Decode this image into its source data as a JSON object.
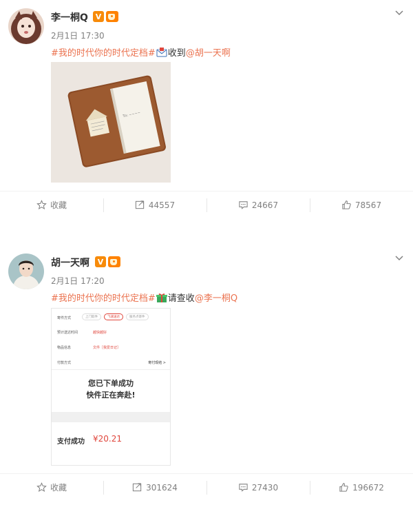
{
  "posts": [
    {
      "username": "李一桐Q",
      "time": "2月1日 17:30",
      "hashtag": "#我的时代你的时代定档#",
      "text": "收到",
      "mention": "@胡一天啊",
      "emoji": "envelope-icon",
      "actions": {
        "favorite": "收藏",
        "repost": "44557",
        "comment": "24667",
        "like": "78567"
      }
    },
    {
      "username": "胡一天啊",
      "time": "2月1日 17:20",
      "hashtag": "#我的时代你的时代定档#",
      "text": "请查收",
      "mention": "@李一桐Q",
      "emoji": "gift-icon",
      "actions": {
        "favorite": "收藏",
        "repost": "301624",
        "comment": "27430",
        "like": "196672"
      },
      "screenshot": {
        "rows": [
          {
            "label": "寄件方式",
            "options": [
              "上门取件",
              "飞速送达",
              "服务点寄件"
            ]
          },
          {
            "label": "预计送达时间",
            "value": "越快越好"
          },
          {
            "label": "物品信息",
            "value": "文件［我爱日记］"
          },
          {
            "label": "付款方式",
            "value": "寄付现结 >"
          }
        ],
        "message_line1": "您已下单成功",
        "message_line2": "快件正在奔赴!",
        "paid_label": "支付成功",
        "paid_amount": "¥20.21"
      }
    }
  ],
  "colors": {
    "accent": "#eb7350",
    "muted": "#808080",
    "badge": "#f78b0a"
  }
}
